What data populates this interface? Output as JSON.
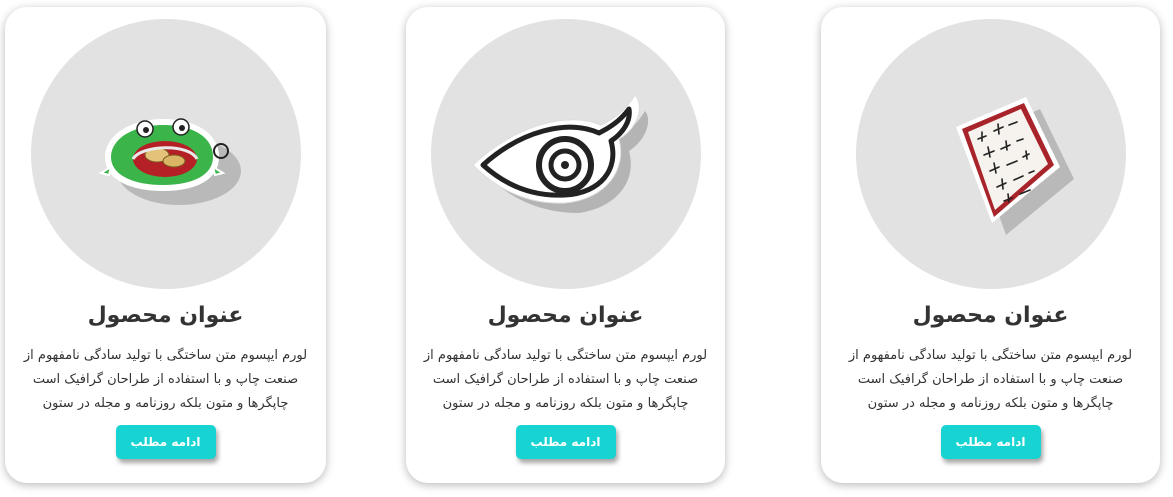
{
  "colors": {
    "card_background": "#ffffff",
    "image_circle": "#e2e2e2",
    "button_background": "#17d3d1",
    "button_text": "#ffffff",
    "title_text": "#333333",
    "body_text": "#333333"
  },
  "cards": [
    {
      "image_icon": "scroll-sticker-icon",
      "title": "عنوان محصول",
      "description": "لورم ایپسوم متن ساختگی با تولید سادگی نامفهوم از صنعت چاپ و با استفاده از طراحان گرافیک است چاپگرها و متون بلکه روزنامه و مجله در ستون",
      "button_label": "ادامه مطلب"
    },
    {
      "image_icon": "leaf-swirl-sticker-icon",
      "title": "عنوان محصول",
      "description": "لورم ایپسوم متن ساختگی با تولید سادگی نامفهوم از صنعت چاپ و با استفاده از طراحان گرافیک است چاپگرها و متون بلکه روزنامه و مجله در ستون",
      "button_label": "ادامه مطلب"
    },
    {
      "image_icon": "frog-wallet-sticker-icon",
      "title": "عنوان محصول",
      "description": "لورم ایپسوم متن ساختگی با تولید سادگی نامفهوم از صنعت چاپ و با استفاده از طراحان گرافیک است چاپگرها و متون بلکه روزنامه و مجله در ستون",
      "button_label": "ادامه مطلب"
    }
  ]
}
